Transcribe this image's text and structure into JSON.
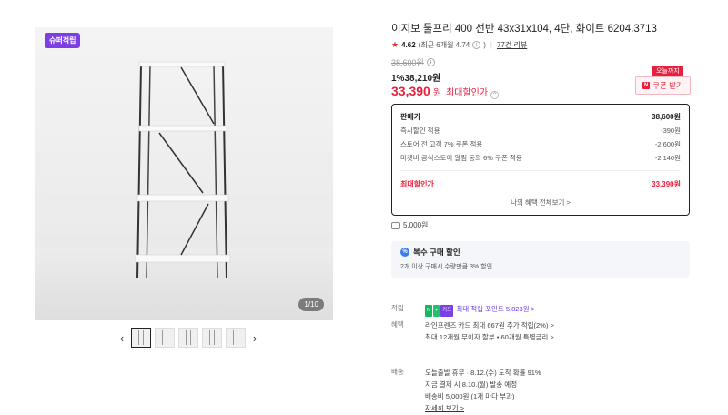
{
  "gallery": {
    "badge": "슈퍼적립",
    "counter": "1/10",
    "prev_icon": "chevron-left-icon",
    "next_icon": "chevron-right-icon",
    "thumbnail_count": 5
  },
  "product": {
    "title": "이지보 툴프리 400 선반 43x31x104, 4단, 화이트 6204.3713",
    "rating": "4.62",
    "rating_recent": "(최근 6개월 4.74",
    "rating_recent_close": ")",
    "reviews": "77건 리뷰",
    "original_price": "38,600원",
    "discount_price": "1%38,210원",
    "max_discount_price": "33,390",
    "max_discount_unit": "원",
    "max_discount_label": "최대할인가",
    "coupon_tag": "오늘까지",
    "coupon_button": "쿠폰 받기",
    "coupon_icon_text": "N"
  },
  "breakdown": {
    "rows": [
      {
        "label": "판매가",
        "value": "38,600원"
      },
      {
        "label": "즉시할인 적용",
        "value": "-390원"
      },
      {
        "label": "스토어 전 고객 7% 쿠폰 적용",
        "value": "-2,600원"
      },
      {
        "label": "마켓비 공식스토어 알림 동의 6% 쿠폰 적용",
        "value": "-2,140원"
      }
    ],
    "total_label": "최대할인가",
    "total_value": "33,390원",
    "more_link": "나의 혜택 전체보기 >"
  },
  "points": {
    "text": "5,000원"
  },
  "multi_buy": {
    "title": "복수 구매 할인",
    "desc": "2개 이상 구매시 수량만큼 3% 할인"
  },
  "details": {
    "accumulate_label": "적립",
    "accumulate_tag1": "N",
    "accumulate_tag2": "+",
    "accumulate_tag3": "카드",
    "accumulate_value": "최대 적립 포인트 5,823원 >",
    "benefit_label": "혜택",
    "benefit_line1": "라인프렌즈 카드 최대 667원 추가 적립(2%) >",
    "benefit_line2": "최대 12개월 무이자 할부 • 60개월 특별금리 >",
    "delivery_label": "배송",
    "delivery_line1": "오늘출발 휴무 · 8.12.(수) 도착 확률 91%",
    "delivery_line2": "지금 결제 시 8.10.(월) 발송 예정",
    "delivery_line3": "배송비 5,000원 (1개 마다 부과)",
    "delivery_link": "자세히 보기 >"
  }
}
